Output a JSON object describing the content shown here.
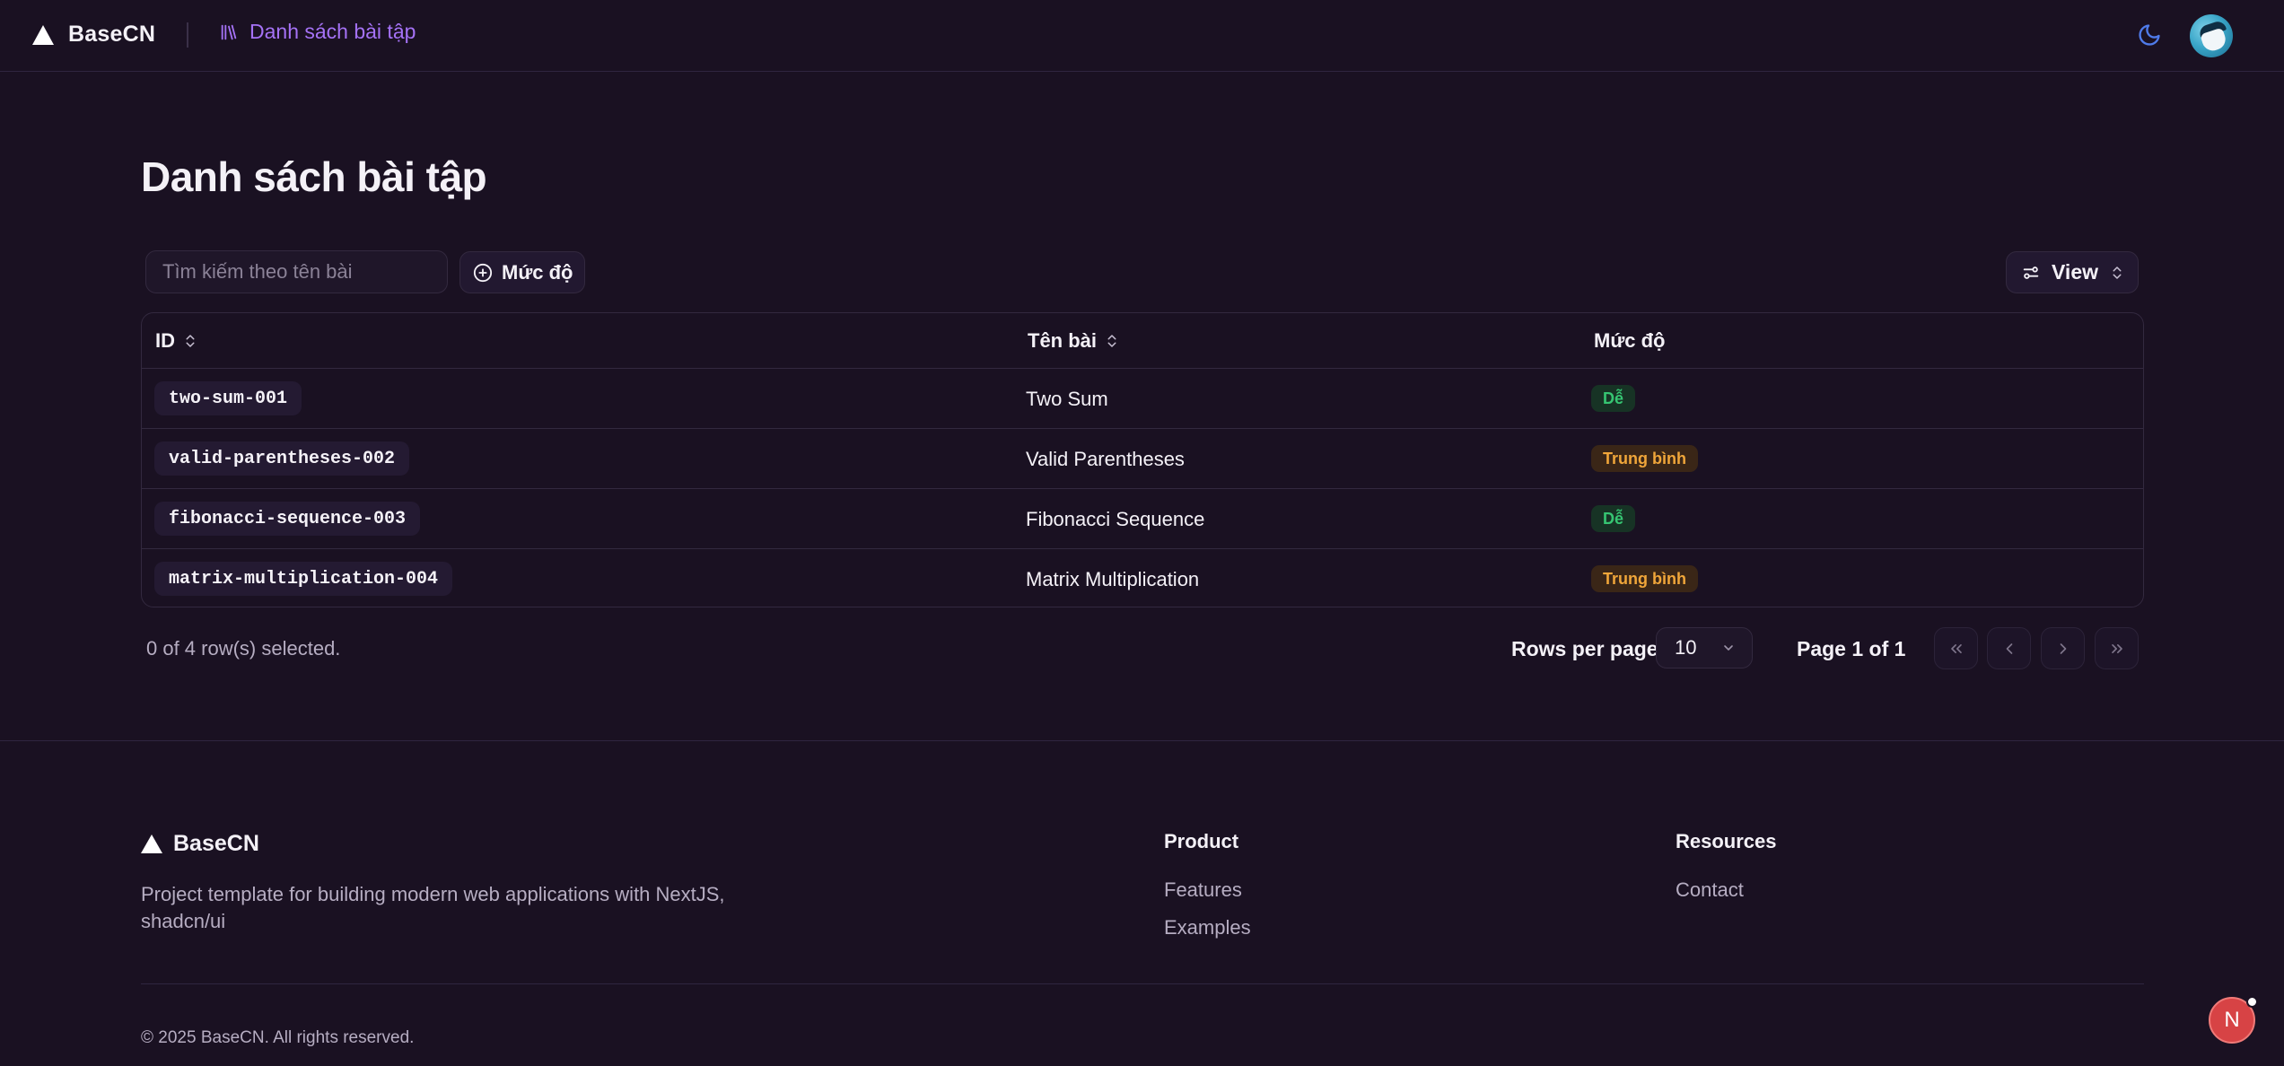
{
  "header": {
    "brand": "BaseCN",
    "nav_label": "Danh sách bài tập"
  },
  "page": {
    "title": "Danh sách bài tập"
  },
  "toolbar": {
    "search_placeholder": "Tìm kiếm theo tên bài",
    "filter_label": "Mức độ",
    "view_label": "View"
  },
  "table": {
    "columns": [
      "ID",
      "Tên bài",
      "Mức độ"
    ],
    "rows": [
      {
        "id": "two-sum-001",
        "name": "Two Sum",
        "level": "Dễ",
        "level_type": "easy"
      },
      {
        "id": "valid-parentheses-002",
        "name": "Valid Parentheses",
        "level": "Trung bình",
        "level_type": "medium"
      },
      {
        "id": "fibonacci-sequence-003",
        "name": "Fibonacci Sequence",
        "level": "Dễ",
        "level_type": "easy"
      },
      {
        "id": "matrix-multiplication-004",
        "name": "Matrix Multiplication",
        "level": "Trung bình",
        "level_type": "medium"
      }
    ]
  },
  "pagination": {
    "selected_text": "0 of 4 row(s) selected.",
    "rows_per_page_label": "Rows per page",
    "rows_per_page_value": "10",
    "page_info": "Page 1 of 1"
  },
  "footer": {
    "brand": "BaseCN",
    "description": "Project template for building modern web applications with NextJS, shadcn/ui",
    "columns": [
      {
        "title": "Product",
        "links": [
          "Features",
          "Examples"
        ]
      },
      {
        "title": "Resources",
        "links": [
          "Contact"
        ]
      }
    ],
    "copyright": "© 2025 BaseCN. All rights reserved."
  },
  "dev_badge": "N",
  "colors": {
    "background": "#1a1122",
    "accent": "#a572f6",
    "easy": "#36c572",
    "medium": "#f0a63a",
    "dev_badge": "#d74345"
  }
}
